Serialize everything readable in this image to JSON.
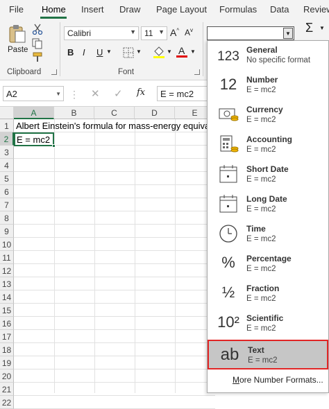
{
  "tabs": [
    {
      "label": "File"
    },
    {
      "label": "Home"
    },
    {
      "label": "Insert"
    },
    {
      "label": "Draw"
    },
    {
      "label": "Page Layout"
    },
    {
      "label": "Formulas"
    },
    {
      "label": "Data"
    },
    {
      "label": "Review"
    }
  ],
  "ribbon": {
    "paste_label": "Paste",
    "clipboard_label": "Clipboard",
    "font_label": "Font",
    "font_name": "Calibri",
    "font_size": "11",
    "bold": "B",
    "italic": "I",
    "underline": "U",
    "autosum": "Σ"
  },
  "formula_bar": {
    "namebox": "A2",
    "fx": "fx",
    "formula": "E = mc2"
  },
  "grid": {
    "columns": [
      "A",
      "B",
      "C",
      "D",
      "E"
    ],
    "rows": [
      "1",
      "2",
      "3",
      "4",
      "5",
      "6",
      "7",
      "8",
      "9",
      "10",
      "11",
      "12",
      "13",
      "14",
      "15",
      "16",
      "17",
      "18",
      "19",
      "20",
      "21",
      "22"
    ],
    "a1": "Albert Einstein's formula for mass-energy equivalence",
    "a2": "E = mc2"
  },
  "number_formats": [
    {
      "name": "General",
      "sample": "No specific format",
      "icon": "123"
    },
    {
      "name": "Number",
      "sample": "E = mc2",
      "icon": "12"
    },
    {
      "name": "Currency",
      "sample": "E = mc2",
      "icon": "currency-icon"
    },
    {
      "name": "Accounting",
      "sample": "E = mc2",
      "icon": "accounting-icon"
    },
    {
      "name": "Short Date",
      "sample": "E = mc2",
      "icon": "calendar-icon"
    },
    {
      "name": "Long Date",
      "sample": "E = mc2",
      "icon": "calendar-icon"
    },
    {
      "name": "Time",
      "sample": "E = mc2",
      "icon": "clock-icon"
    },
    {
      "name": "Percentage",
      "sample": "E = mc2",
      "icon": "%"
    },
    {
      "name": "Fraction",
      "sample": "E = mc2",
      "icon": "½"
    },
    {
      "name": "Scientific",
      "sample": "E = mc2",
      "icon": "10²"
    },
    {
      "name": "Text",
      "sample": "E = mc2",
      "icon": "ab"
    }
  ],
  "more_formats": "More Number Formats...",
  "colors": {
    "accent": "#217346",
    "highlight": "#e22525"
  }
}
